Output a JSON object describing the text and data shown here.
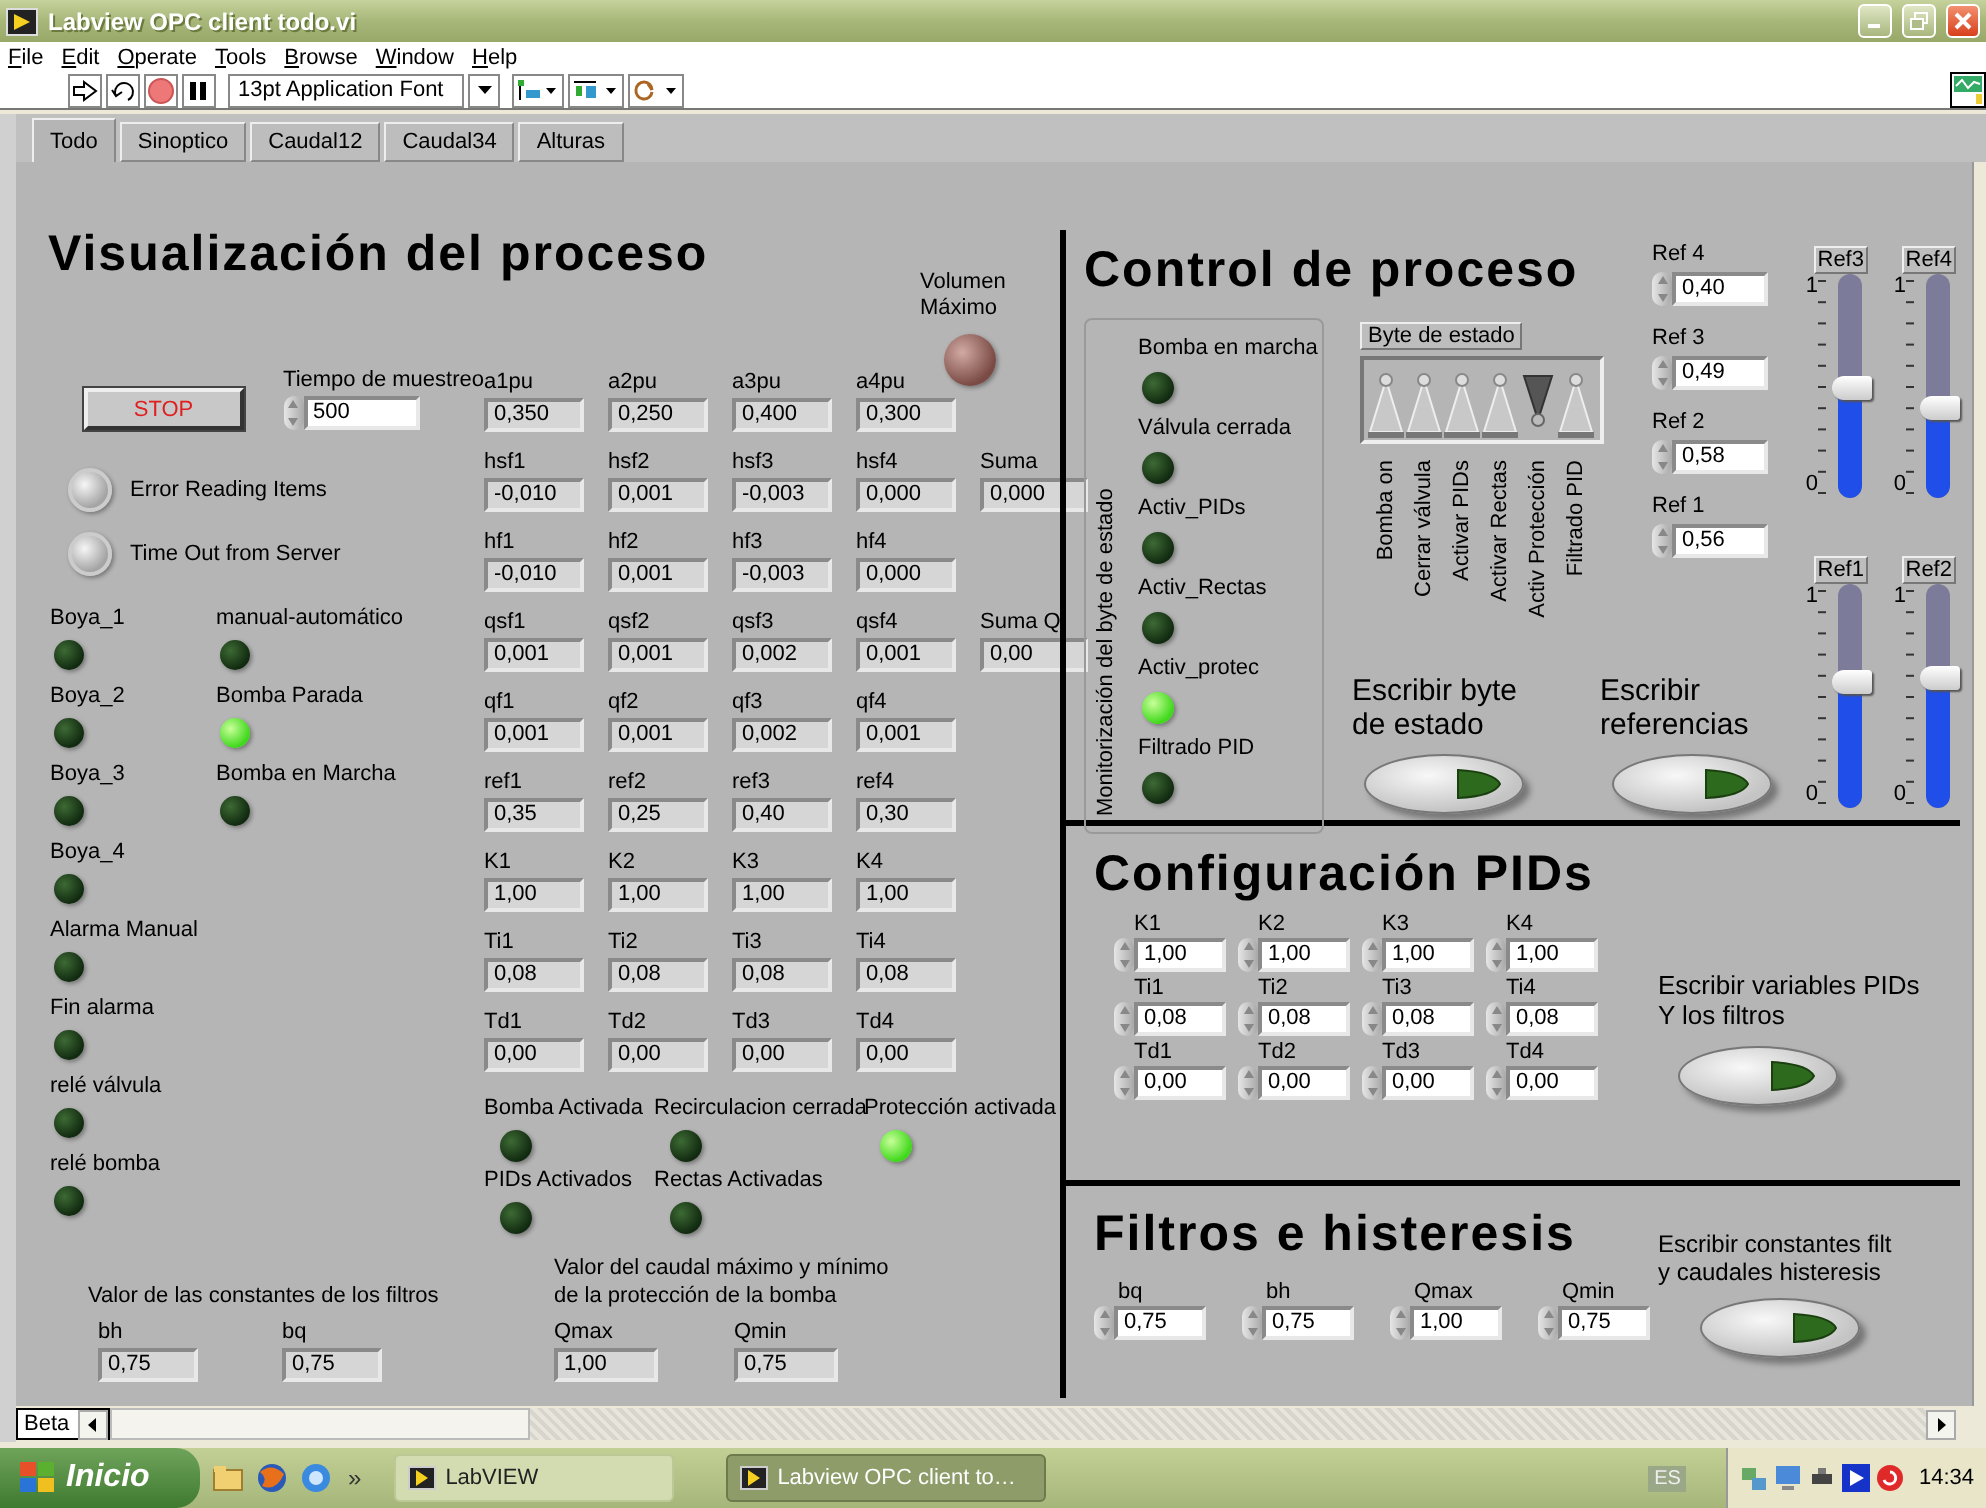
{
  "window": {
    "title": "Labview OPC client todo.vi"
  },
  "menu": [
    "File",
    "Edit",
    "Operate",
    "Tools",
    "Browse",
    "Window",
    "Help"
  ],
  "toolbar": {
    "font": "13pt Application Font"
  },
  "tabs": [
    {
      "label": "Todo",
      "selected": true
    },
    {
      "label": "Sinoptico",
      "selected": false
    },
    {
      "label": "Caudal12",
      "selected": false
    },
    {
      "label": "Caudal34",
      "selected": false
    },
    {
      "label": "Alturas",
      "selected": false
    }
  ],
  "visualization": {
    "title": "Visualización del proceso",
    "max_volume": {
      "label": "Volumen Máximo",
      "on": false
    },
    "stop": "STOP",
    "sampling_time": {
      "label": "Tiempo de muestreo",
      "value": "500"
    },
    "status_lights": [
      {
        "label": "Error Reading Items",
        "on": false
      },
      {
        "label": "Time Out from Server",
        "on": false
      }
    ],
    "lights_left": [
      {
        "label": "Boya_1",
        "on": false
      },
      {
        "label": "Boya_2",
        "on": false
      },
      {
        "label": "Boya_3",
        "on": false
      },
      {
        "label": "Boya_4",
        "on": false
      },
      {
        "label": "Alarma Manual",
        "on": false
      },
      {
        "label": "Fin alarma",
        "on": false
      },
      {
        "label": "relé válvula",
        "on": false
      },
      {
        "label": "relé bomba",
        "on": false
      }
    ],
    "lights_right": [
      {
        "label": "manual-automático",
        "on": false
      },
      {
        "label": "Bomba Parada",
        "on": true
      },
      {
        "label": "Bomba en Marcha",
        "on": false
      }
    ],
    "rows": [
      {
        "cells": [
          {
            "label": "a1pu",
            "value": "0,350"
          },
          {
            "label": "a2pu",
            "value": "0,250"
          },
          {
            "label": "a3pu",
            "value": "0,400"
          },
          {
            "label": "a4pu",
            "value": "0,300"
          }
        ]
      },
      {
        "cells": [
          {
            "label": "hsf1",
            "value": "-0,010"
          },
          {
            "label": "hsf2",
            "value": "0,001"
          },
          {
            "label": "hsf3",
            "value": "-0,003"
          },
          {
            "label": "hsf4",
            "value": "0,000"
          }
        ],
        "total": {
          "label": "Suma",
          "value": "0,000"
        }
      },
      {
        "cells": [
          {
            "label": "hf1",
            "value": "-0,010"
          },
          {
            "label": "hf2",
            "value": "0,001"
          },
          {
            "label": "hf3",
            "value": "-0,003"
          },
          {
            "label": "hf4",
            "value": "0,000"
          }
        ]
      },
      {
        "cells": [
          {
            "label": "qsf1",
            "value": "0,001"
          },
          {
            "label": "qsf2",
            "value": "0,001"
          },
          {
            "label": "qsf3",
            "value": "0,002"
          },
          {
            "label": "qsf4",
            "value": "0,001"
          }
        ],
        "total": {
          "label": "Suma Q",
          "value": "0,00"
        }
      },
      {
        "cells": [
          {
            "label": "qf1",
            "value": "0,001"
          },
          {
            "label": "qf2",
            "value": "0,001"
          },
          {
            "label": "qf3",
            "value": "0,002"
          },
          {
            "label": "qf4",
            "value": "0,001"
          }
        ]
      },
      {
        "cells": [
          {
            "label": "ref1",
            "value": "0,35"
          },
          {
            "label": "ref2",
            "value": "0,25"
          },
          {
            "label": "ref3",
            "value": "0,40"
          },
          {
            "label": "ref4",
            "value": "0,30"
          }
        ]
      },
      {
        "cells": [
          {
            "label": "K1",
            "value": "1,00"
          },
          {
            "label": "K2",
            "value": "1,00"
          },
          {
            "label": "K3",
            "value": "1,00"
          },
          {
            "label": "K4",
            "value": "1,00"
          }
        ]
      },
      {
        "cells": [
          {
            "label": "Ti1",
            "value": "0,08"
          },
          {
            "label": "Ti2",
            "value": "0,08"
          },
          {
            "label": "Ti3",
            "value": "0,08"
          },
          {
            "label": "Ti4",
            "value": "0,08"
          }
        ]
      },
      {
        "cells": [
          {
            "label": "Td1",
            "value": "0,00"
          },
          {
            "label": "Td2",
            "value": "0,00"
          },
          {
            "label": "Td3",
            "value": "0,00"
          },
          {
            "label": "Td4",
            "value": "0,00"
          }
        ]
      }
    ],
    "indicators": [
      {
        "label": "Bomba Activada",
        "on": false
      },
      {
        "label": "Recirculacion cerrada",
        "on": false
      },
      {
        "label": "Protección activada",
        "on": true
      },
      {
        "label": "PIDs Activados",
        "on": false
      },
      {
        "label": "Rectas Activadas",
        "on": false
      }
    ],
    "filter_constants": {
      "caption": "Valor de las constantes de los filtros",
      "fields": [
        {
          "label": "bh",
          "value": "0,75"
        },
        {
          "label": "bq",
          "value": "0,75"
        }
      ]
    },
    "pump_protection": {
      "caption_lines": [
        "Valor del caudal máximo y mínimo",
        "de la protección de la bomba"
      ],
      "fields": [
        {
          "label": "Qmax",
          "value": "1,00"
        },
        {
          "label": "Qmin",
          "value": "0,75"
        }
      ]
    }
  },
  "control": {
    "title": "Control de proceso",
    "monitor": {
      "caption": "Monitorización del byte de estado",
      "lights": [
        {
          "label": "Bomba en marcha",
          "on": false
        },
        {
          "label": "Válvula cerrada",
          "on": false
        },
        {
          "label": "Activ_PIDs",
          "on": false
        },
        {
          "label": "Activ_Rectas",
          "on": false
        },
        {
          "label": "Activ_protec",
          "on": true
        },
        {
          "label": "Filtrado PID",
          "on": false
        }
      ]
    },
    "status_byte": {
      "label": "Byte de estado",
      "bits": [
        {
          "label": "Bomba on",
          "on": false
        },
        {
          "label": "Cerrar válvula",
          "on": false
        },
        {
          "label": "Activar PIDs",
          "on": false
        },
        {
          "label": "Activar Rectas",
          "on": false
        },
        {
          "label": "Activ Protección",
          "on": true
        },
        {
          "label": "Filtrado PID",
          "on": false
        }
      ]
    },
    "write_byte_lines": [
      "Escribir byte",
      "de estado"
    ],
    "write_refs_lines": [
      "Escribir",
      "referencias"
    ],
    "refs": [
      {
        "label": "Ref 4",
        "value": "0,40"
      },
      {
        "label": "Ref 3",
        "value": "0,49"
      },
      {
        "label": "Ref 2",
        "value": "0,58"
      },
      {
        "label": "Ref 1",
        "value": "0,56"
      }
    ],
    "sliders": [
      {
        "label": "Ref3",
        "max": "1",
        "min": "0",
        "level": 0.49
      },
      {
        "label": "Ref4",
        "max": "1",
        "min": "0",
        "level": 0.4
      },
      {
        "label": "Ref1",
        "max": "1",
        "min": "0",
        "level": 0.56
      },
      {
        "label": "Ref2",
        "max": "1",
        "min": "0",
        "level": 0.58
      }
    ]
  },
  "pid_config": {
    "title": "Configuración PIDs",
    "rows": [
      [
        {
          "label": "K1",
          "value": "1,00"
        },
        {
          "label": "K2",
          "value": "1,00"
        },
        {
          "label": "K3",
          "value": "1,00"
        },
        {
          "label": "K4",
          "value": "1,00"
        }
      ],
      [
        {
          "label": "Ti1",
          "value": "0,08"
        },
        {
          "label": "Ti2",
          "value": "0,08"
        },
        {
          "label": "Ti3",
          "value": "0,08"
        },
        {
          "label": "Ti4",
          "value": "0,08"
        }
      ],
      [
        {
          "label": "Td1",
          "value": "0,00"
        },
        {
          "label": "Td2",
          "value": "0,00"
        },
        {
          "label": "Td3",
          "value": "0,00"
        },
        {
          "label": "Td4",
          "value": "0,00"
        }
      ]
    ],
    "button_lines": [
      "Escribir variables PIDs",
      "Y los filtros"
    ]
  },
  "filters": {
    "title": "Filtros e histeresis",
    "fields": [
      {
        "label": "bq",
        "value": "0,75"
      },
      {
        "label": "bh",
        "value": "0,75"
      },
      {
        "label": "Qmax",
        "value": "1,00"
      },
      {
        "label": "Qmin",
        "value": "0,75"
      }
    ],
    "button_lines": [
      "Escribir constantes filt",
      "y caudales histeresis"
    ]
  },
  "scrollbar": {
    "label": "Beta"
  },
  "taskbar": {
    "start": "Inicio",
    "more": "»",
    "tasks": [
      {
        "label": "LabVIEW",
        "selected": false
      },
      {
        "label": "Labview OPC client to…",
        "selected": true
      }
    ],
    "language": "ES",
    "clock": "14:34"
  }
}
